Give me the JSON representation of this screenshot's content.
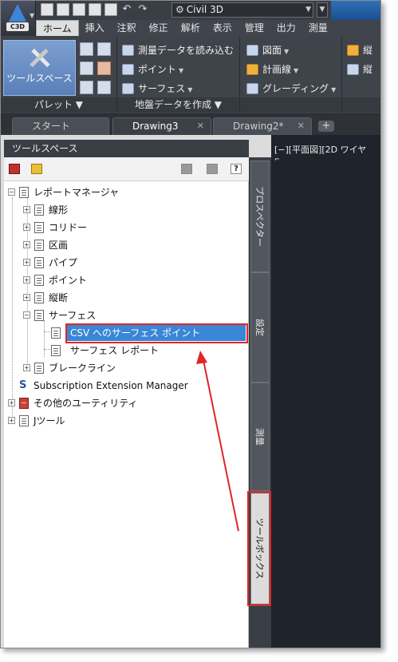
{
  "app": {
    "badge": "C3D",
    "workspace": "Civil 3D"
  },
  "ribbon_tabs": [
    "ホーム",
    "挿入",
    "注釈",
    "修正",
    "解析",
    "表示",
    "管理",
    "出力",
    "測量"
  ],
  "ribbon": {
    "palette_group": "パレット",
    "toolspace_button": "ツールスペース",
    "ground_group": "地盤データを作成",
    "survey_import": "測量データを読み込む",
    "point": "ポイント",
    "surface": "サーフェス",
    "alignment": "図面",
    "profile": "計画線",
    "grading": "グレーディング",
    "cut1": "縦",
    "cut2": "縦"
  },
  "file_tabs": [
    {
      "label": "スタート",
      "active": false
    },
    {
      "label": "Drawing3",
      "active": true
    },
    {
      "label": "Drawing2*",
      "active": false
    }
  ],
  "palette": {
    "title": "ツールスペース",
    "help": "?",
    "tree": {
      "report_manager": "レポートマネージャ",
      "alignment": "線形",
      "corridor": "コリドー",
      "section": "区画",
      "pipe": "パイプ",
      "point": "ポイント",
      "profile": "縦断",
      "surface": "サーフェス",
      "csv_surface_points": "CSV へのサーフェス ポイント",
      "surface_report": "サーフェス レポート",
      "breakline": "ブレークライン",
      "subscription": "Subscription Extension Manager",
      "other_utilities": "その他のユーティリティ",
      "j_tools": "Jツール"
    }
  },
  "side_tabs": {
    "prospector": "プロスペクター",
    "settings": "設定",
    "survey": "測量",
    "toolbox": "ツールボックス"
  },
  "viewport": {
    "label": "[−][平面図][2D ワイヤ"
  },
  "colors": {
    "highlight": "#3a86d6",
    "annotation_red": "#e02626"
  }
}
